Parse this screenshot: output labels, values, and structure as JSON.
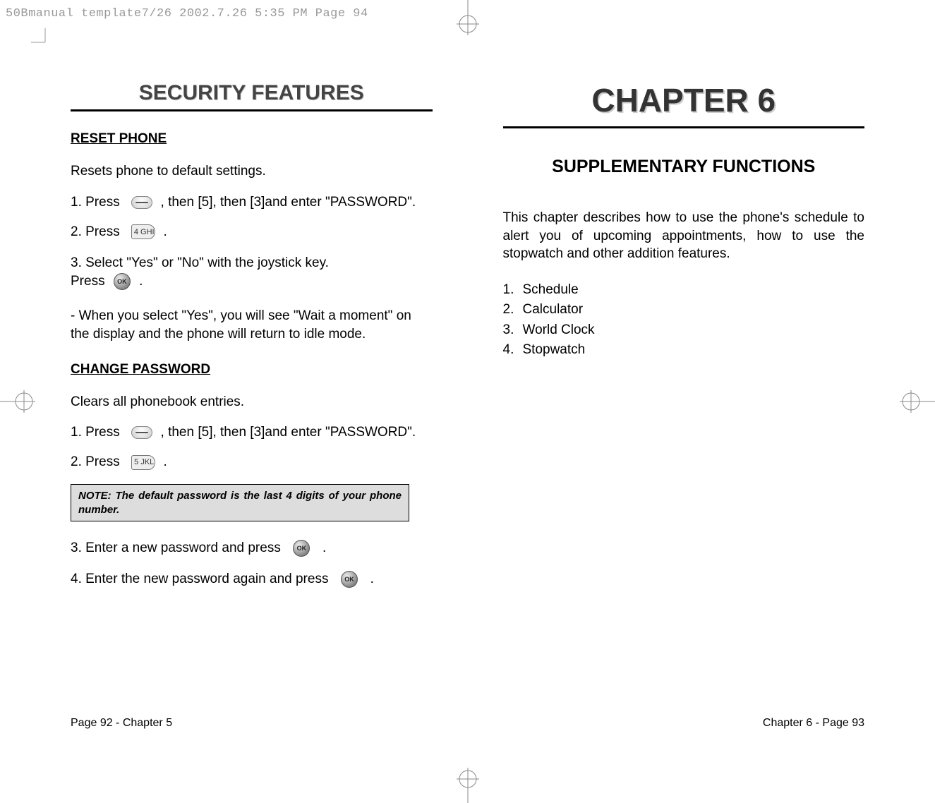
{
  "header": {
    "line": "50Bmanual template7/26  2002.7.26  5:35 PM  Page 94"
  },
  "left": {
    "sectionTitle": "SECURITY FEATURES",
    "h1": "RESET PHONE",
    "p1": "Resets phone to default settings.",
    "s1a": "1. Press  ",
    "s1b": " , then [5], then [3]and enter \"PASSWORD\".",
    "s2a": "2. Press  ",
    "s2b": " .",
    "key4": "4 GHI",
    "s3": "3. Select \"Yes\" or \"No\" with the joystick key.",
    "s3p_a": "Press ",
    "s3p_b": " .",
    "p2": "- When you select \"Yes\", you will see \"Wait a moment\" on the display and the phone will return to idle mode.",
    "h2": "CHANGE PASSWORD",
    "p3": "Clears all phonebook entries.",
    "s4a": "1. Press  ",
    "s4b": " , then [5], then [3]and enter \"PASSWORD\".",
    "s5a": "2. Press  ",
    "s5b": " .",
    "key5": "5 JKL",
    "noteLabel": "NOTE:",
    "noteText": " The default password is the last 4 digits of your phone number.",
    "s6a": "3. Enter a new password and press  ",
    "s6b": "  .",
    "s7a": "4. Enter the new password again and press  ",
    "s7b": "  .",
    "footer": "Page 92 - Chapter 5"
  },
  "right": {
    "chapterTitle": "CHAPTER 6",
    "subTitle": "SUPPLEMENTARY FUNCTIONS",
    "intro": "This chapter describes how to use the phone's schedule to alert you of upcoming appointments, how to use the stopwatch and other addition features.",
    "items": [
      "Schedule",
      "Calculator",
      "World Clock",
      "Stopwatch"
    ],
    "nums": [
      "1.",
      "2.",
      "3.",
      "4."
    ],
    "footer": "Chapter 6 - Page 93"
  },
  "icons": {
    "ok": "OK"
  }
}
